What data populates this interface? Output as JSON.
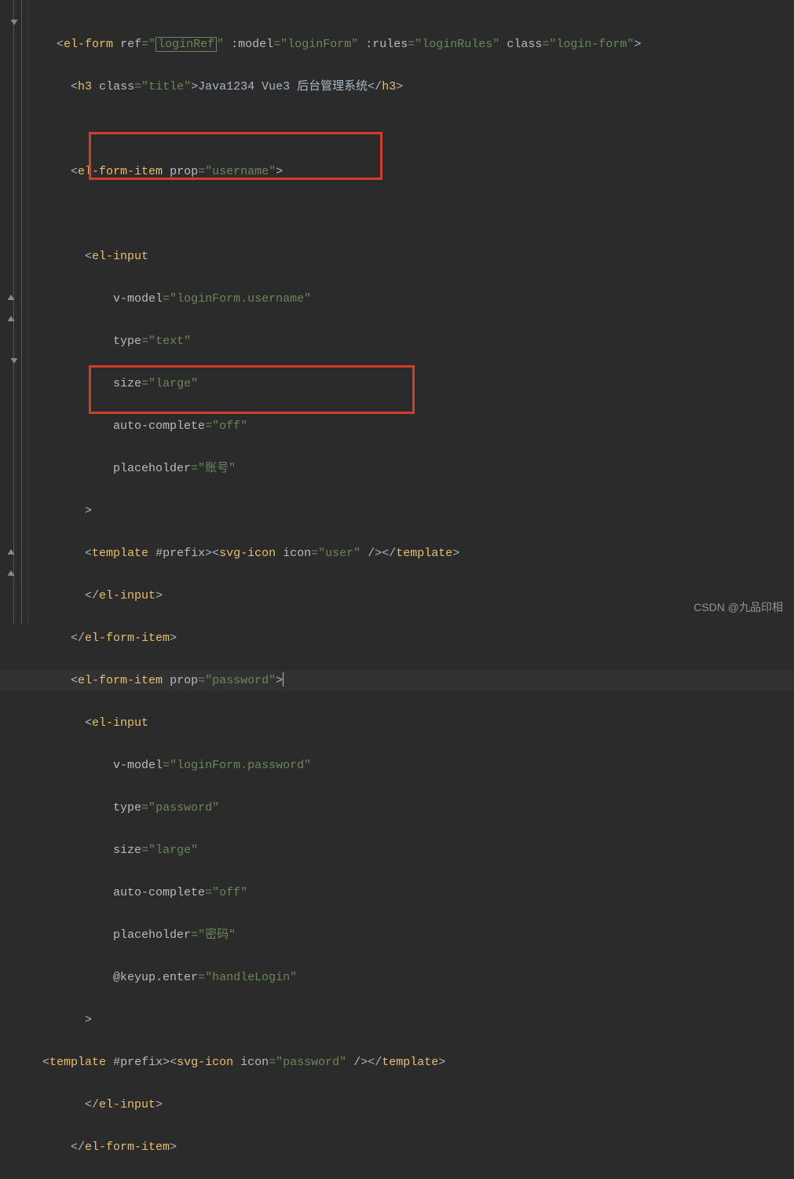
{
  "code": {
    "tag_el_form": "el-form",
    "attr_ref": "ref",
    "val_loginRef": "loginRef",
    "attr_model": ":model",
    "val_loginForm": "loginForm",
    "attr_rules": ":rules",
    "val_loginRules": "loginRules",
    "attr_class": "class",
    "val_login_form": "login-form",
    "tag_h3": "h3",
    "val_title": "title",
    "h3_text": "Java1234 Vue3 后台管理系统",
    "tag_el_form_item": "el-form-item",
    "attr_prop": "prop",
    "val_username": "username",
    "tag_el_input": "el-input",
    "attr_vmodel": "v-model",
    "val_lf_username": "loginForm.username",
    "attr_type": "type",
    "val_text": "text",
    "attr_size": "size",
    "val_large": "large",
    "attr_autocomplete": "auto-complete",
    "val_off": "off",
    "attr_placeholder": "placeholder",
    "val_account": "账号",
    "tag_template": "template",
    "attr_prefix": "#prefix",
    "tag_svg_icon": "svg-icon",
    "attr_icon": "icon",
    "val_user": "user",
    "val_password_prop": "password",
    "val_lf_password": "loginForm.password",
    "val_password_type": "password",
    "val_mima": "密码",
    "attr_keyup": "@keyup.enter",
    "val_handleLogin": "handleLogin",
    "val_password_icon": "password"
  },
  "watermark": "CSDN @九品印相"
}
